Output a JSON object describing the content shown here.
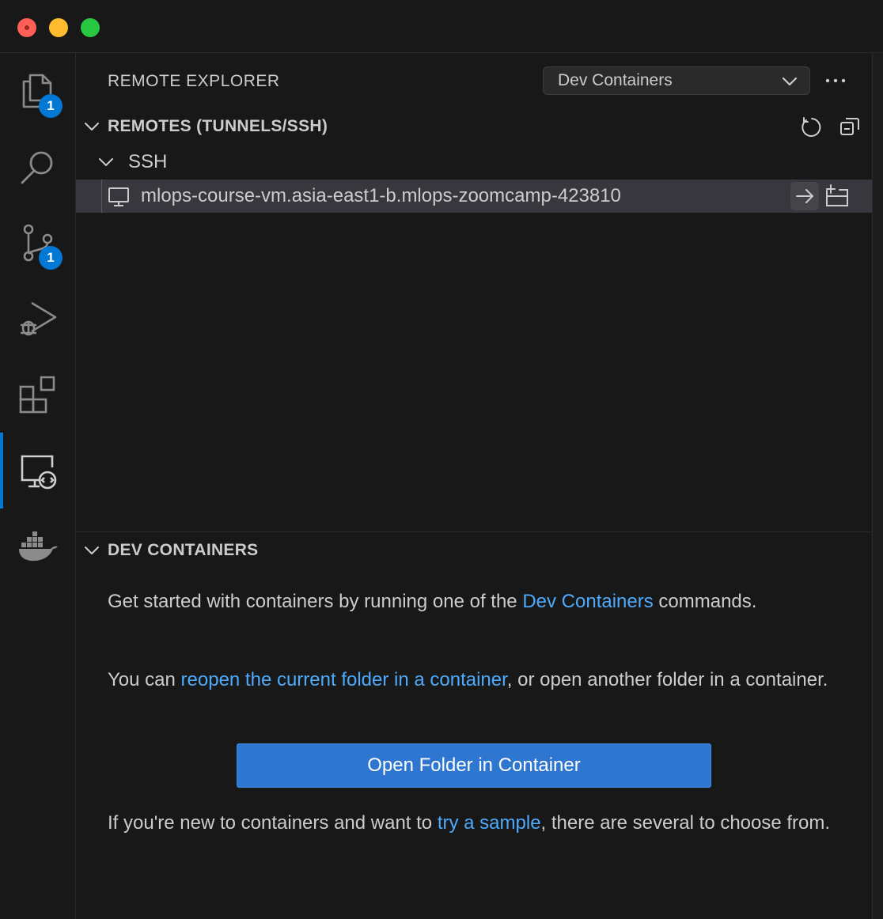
{
  "window": {
    "controls": [
      "close",
      "minimize",
      "maximize"
    ]
  },
  "activity_bar": {
    "items": [
      {
        "name": "explorer-icon",
        "badge": "1"
      },
      {
        "name": "search-icon",
        "badge": null
      },
      {
        "name": "source-control-icon",
        "badge": "1"
      },
      {
        "name": "run-debug-icon",
        "badge": null
      },
      {
        "name": "extensions-icon",
        "badge": null
      },
      {
        "name": "remote-explorer-icon",
        "badge": null,
        "active": true
      },
      {
        "name": "docker-icon",
        "badge": null
      }
    ],
    "badges": {
      "explorer": "1",
      "source_control": "1"
    },
    "accent_color": "#0078d4"
  },
  "sidebar": {
    "title": "REMOTE EXPLORER",
    "dropdown": {
      "selected": "Dev Containers"
    },
    "more_icon": "ellipsis-icon",
    "remotes_section": {
      "title": "REMOTES (TUNNELS/SSH)",
      "actions": [
        "refresh-icon",
        "collapse-all-icon"
      ],
      "group": {
        "label": "SSH"
      },
      "host": {
        "label": "mlops-course-vm.asia-east1-b.mlops-zoomcamp-423810",
        "actions": [
          "connect-in-current-window-icon",
          "connect-in-new-window-icon"
        ]
      }
    },
    "dev_containers_section": {
      "title": "DEV CONTAINERS",
      "p1": {
        "before": "Get started with containers by running one of the ",
        "link": "Dev Containers",
        "after": " commands."
      },
      "p2": {
        "before": "You can ",
        "link": "reopen the current folder in a container",
        "after": ", or open another folder in a container."
      },
      "button_label": "Open Folder in Container",
      "p3": {
        "before": "If you're new to containers and want to ",
        "link": "try a sample",
        "after": ", there are several to choose from."
      }
    }
  },
  "colors": {
    "background": "#181818",
    "link": "#4daafc",
    "button": "#2f76d0",
    "selection": "#37373d"
  }
}
